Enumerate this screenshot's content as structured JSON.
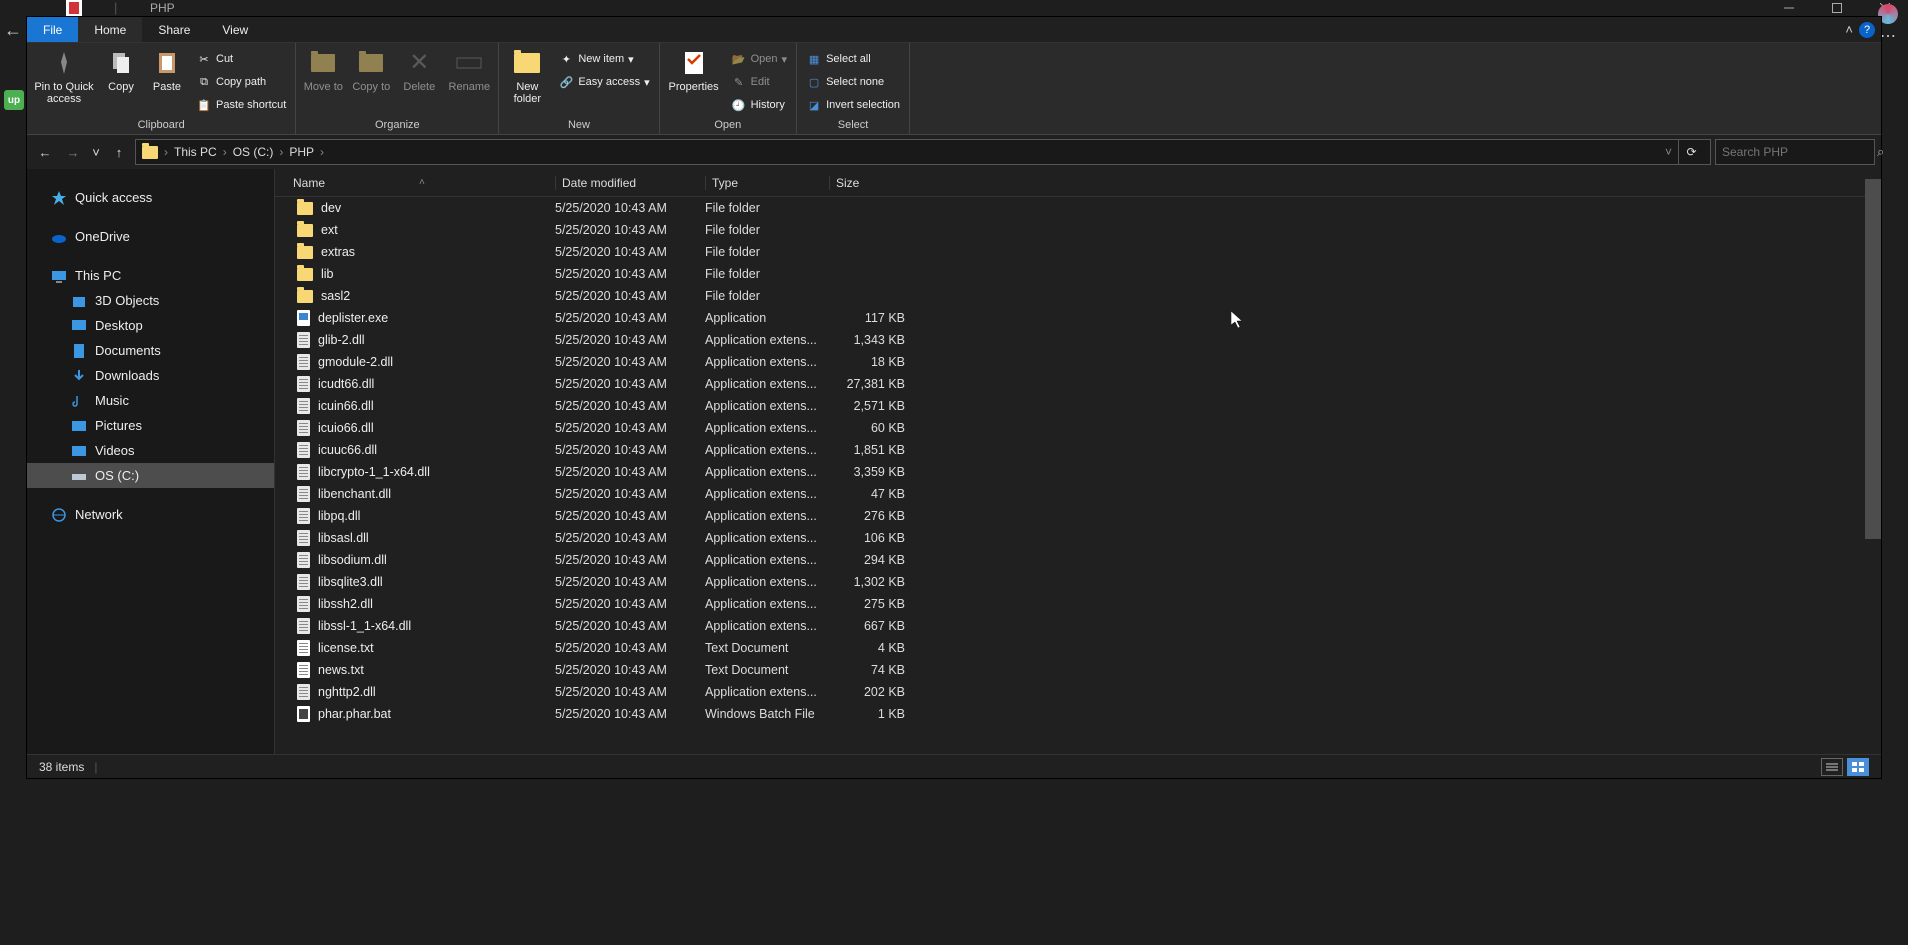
{
  "window_title": "PHP",
  "tabs": {
    "file": "File",
    "home": "Home",
    "share": "Share",
    "view": "View"
  },
  "ribbon": {
    "clipboard": {
      "label": "Clipboard",
      "pin": "Pin to Quick access",
      "copy": "Copy",
      "paste": "Paste",
      "cut": "Cut",
      "copy_path": "Copy path",
      "paste_shortcut": "Paste shortcut"
    },
    "organize": {
      "label": "Organize",
      "move": "Move to",
      "copy": "Copy to",
      "delete": "Delete",
      "rename": "Rename"
    },
    "new": {
      "label": "New",
      "new_folder": "New folder",
      "new_item": "New item",
      "easy_access": "Easy access"
    },
    "open": {
      "label": "Open",
      "properties": "Properties",
      "open": "Open",
      "edit": "Edit",
      "history": "History"
    },
    "select": {
      "label": "Select",
      "select_all": "Select all",
      "select_none": "Select none",
      "invert": "Invert selection"
    }
  },
  "breadcrumb": [
    "This PC",
    "OS (C:)",
    "PHP"
  ],
  "search_placeholder": "Search PHP",
  "tree": {
    "quick": "Quick access",
    "onedrive": "OneDrive",
    "thispc": "This PC",
    "subs": [
      "3D Objects",
      "Desktop",
      "Documents",
      "Downloads",
      "Music",
      "Pictures",
      "Videos",
      "OS (C:)"
    ],
    "network": "Network"
  },
  "columns": {
    "name": "Name",
    "date": "Date modified",
    "type": "Type",
    "size": "Size"
  },
  "files": [
    {
      "name": "dev",
      "date": "5/25/2020 10:43 AM",
      "type": "File folder",
      "size": "",
      "icon": "folder"
    },
    {
      "name": "ext",
      "date": "5/25/2020 10:43 AM",
      "type": "File folder",
      "size": "",
      "icon": "folder"
    },
    {
      "name": "extras",
      "date": "5/25/2020 10:43 AM",
      "type": "File folder",
      "size": "",
      "icon": "folder"
    },
    {
      "name": "lib",
      "date": "5/25/2020 10:43 AM",
      "type": "File folder",
      "size": "",
      "icon": "folder"
    },
    {
      "name": "sasl2",
      "date": "5/25/2020 10:43 AM",
      "type": "File folder",
      "size": "",
      "icon": "folder"
    },
    {
      "name": "deplister.exe",
      "date": "5/25/2020 10:43 AM",
      "type": "Application",
      "size": "117 KB",
      "icon": "exe"
    },
    {
      "name": "glib-2.dll",
      "date": "5/25/2020 10:43 AM",
      "type": "Application extens...",
      "size": "1,343 KB",
      "icon": "dll"
    },
    {
      "name": "gmodule-2.dll",
      "date": "5/25/2020 10:43 AM",
      "type": "Application extens...",
      "size": "18 KB",
      "icon": "dll"
    },
    {
      "name": "icudt66.dll",
      "date": "5/25/2020 10:43 AM",
      "type": "Application extens...",
      "size": "27,381 KB",
      "icon": "dll"
    },
    {
      "name": "icuin66.dll",
      "date": "5/25/2020 10:43 AM",
      "type": "Application extens...",
      "size": "2,571 KB",
      "icon": "dll"
    },
    {
      "name": "icuio66.dll",
      "date": "5/25/2020 10:43 AM",
      "type": "Application extens...",
      "size": "60 KB",
      "icon": "dll"
    },
    {
      "name": "icuuc66.dll",
      "date": "5/25/2020 10:43 AM",
      "type": "Application extens...",
      "size": "1,851 KB",
      "icon": "dll"
    },
    {
      "name": "libcrypto-1_1-x64.dll",
      "date": "5/25/2020 10:43 AM",
      "type": "Application extens...",
      "size": "3,359 KB",
      "icon": "dll"
    },
    {
      "name": "libenchant.dll",
      "date": "5/25/2020 10:43 AM",
      "type": "Application extens...",
      "size": "47 KB",
      "icon": "dll"
    },
    {
      "name": "libpq.dll",
      "date": "5/25/2020 10:43 AM",
      "type": "Application extens...",
      "size": "276 KB",
      "icon": "dll"
    },
    {
      "name": "libsasl.dll",
      "date": "5/25/2020 10:43 AM",
      "type": "Application extens...",
      "size": "106 KB",
      "icon": "dll"
    },
    {
      "name": "libsodium.dll",
      "date": "5/25/2020 10:43 AM",
      "type": "Application extens...",
      "size": "294 KB",
      "icon": "dll"
    },
    {
      "name": "libsqlite3.dll",
      "date": "5/25/2020 10:43 AM",
      "type": "Application extens...",
      "size": "1,302 KB",
      "icon": "dll"
    },
    {
      "name": "libssh2.dll",
      "date": "5/25/2020 10:43 AM",
      "type": "Application extens...",
      "size": "275 KB",
      "icon": "dll"
    },
    {
      "name": "libssl-1_1-x64.dll",
      "date": "5/25/2020 10:43 AM",
      "type": "Application extens...",
      "size": "667 KB",
      "icon": "dll"
    },
    {
      "name": "license.txt",
      "date": "5/25/2020 10:43 AM",
      "type": "Text Document",
      "size": "4 KB",
      "icon": "txt"
    },
    {
      "name": "news.txt",
      "date": "5/25/2020 10:43 AM",
      "type": "Text Document",
      "size": "74 KB",
      "icon": "txt"
    },
    {
      "name": "nghttp2.dll",
      "date": "5/25/2020 10:43 AM",
      "type": "Application extens...",
      "size": "202 KB",
      "icon": "dll"
    },
    {
      "name": "phar.phar.bat",
      "date": "5/25/2020 10:43 AM",
      "type": "Windows Batch File",
      "size": "1 KB",
      "icon": "bat"
    }
  ],
  "status": {
    "items": "38 items"
  },
  "tree_icons": [
    "#47aee8",
    "#0a63c9",
    "#3b97e2",
    "#3b97e2",
    "#3b97e2",
    "#3b97e2",
    "#3b97e2",
    "#3b97e2",
    "#3b97e2",
    "#3b97e2",
    "#bcc8d4",
    "#3b97e2"
  ]
}
